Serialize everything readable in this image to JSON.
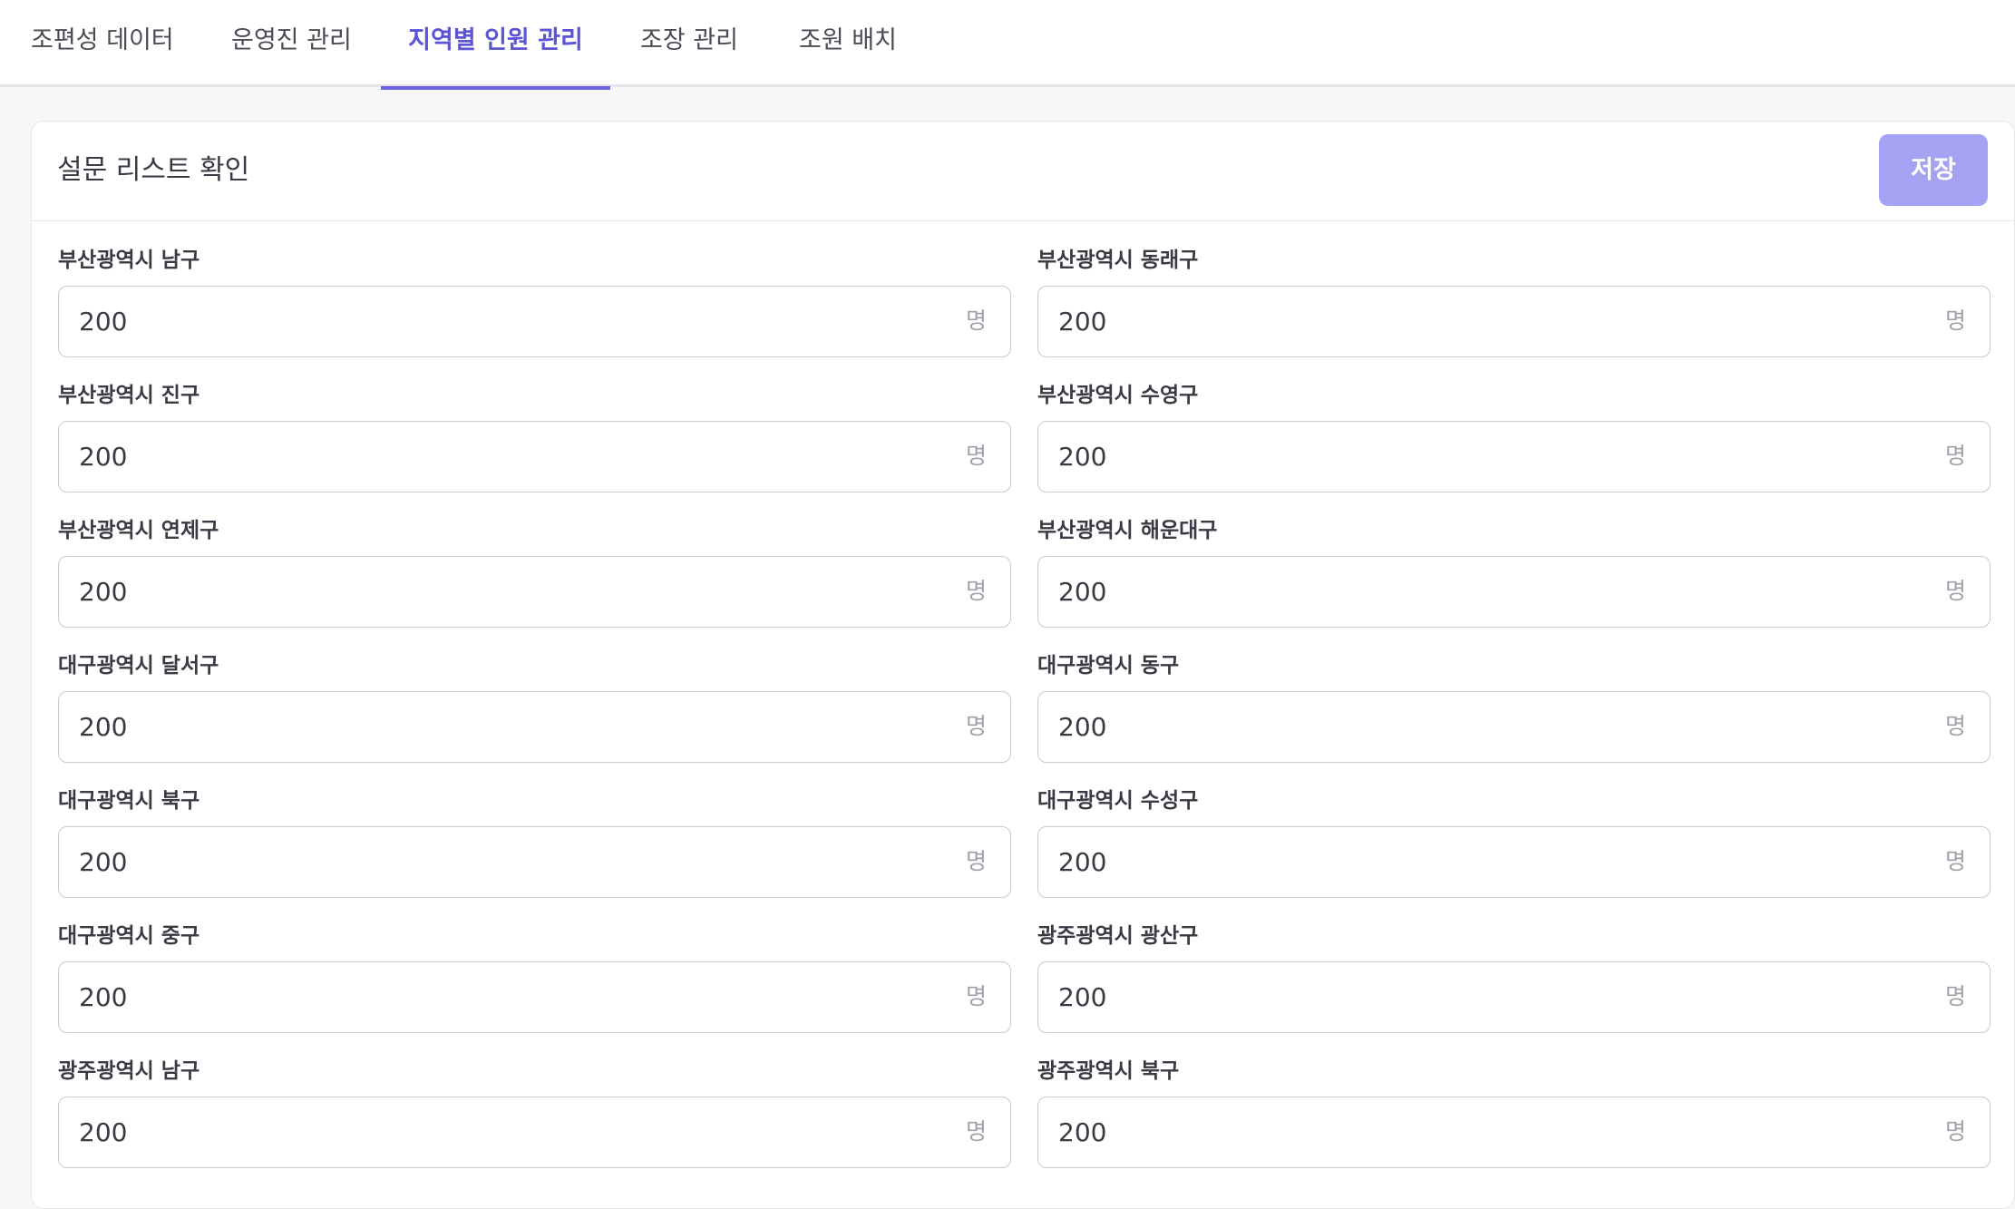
{
  "tabs": [
    {
      "label": "조편성 데이터"
    },
    {
      "label": "운영진 관리"
    },
    {
      "label": "지역별 인원 관리"
    },
    {
      "label": "조장 관리"
    },
    {
      "label": "조원 배치"
    }
  ],
  "active_tab": "지역별 인원 관리",
  "card": {
    "title": "설문 리스트 확인",
    "save_label": "저장"
  },
  "fields": [
    {
      "label": "부산광역시 남구",
      "value": "200",
      "unit": "명"
    },
    {
      "label": "부산광역시 동래구",
      "value": "200",
      "unit": "명"
    },
    {
      "label": "부산광역시 진구",
      "value": "200",
      "unit": "명"
    },
    {
      "label": "부산광역시 수영구",
      "value": "200",
      "unit": "명"
    },
    {
      "label": "부산광역시 연제구",
      "value": "200",
      "unit": "명"
    },
    {
      "label": "부산광역시 해운대구",
      "value": "200",
      "unit": "명"
    },
    {
      "label": "대구광역시 달서구",
      "value": "200",
      "unit": "명"
    },
    {
      "label": "대구광역시 동구",
      "value": "200",
      "unit": "명"
    },
    {
      "label": "대구광역시 북구",
      "value": "200",
      "unit": "명"
    },
    {
      "label": "대구광역시 수성구",
      "value": "200",
      "unit": "명"
    },
    {
      "label": "대구광역시 중구",
      "value": "200",
      "unit": "명"
    },
    {
      "label": "광주광역시 광산구",
      "value": "200",
      "unit": "명"
    },
    {
      "label": "광주광역시 남구",
      "value": "200",
      "unit": "명"
    },
    {
      "label": "광주광역시 북구",
      "value": "200",
      "unit": "명"
    }
  ],
  "colors": {
    "accent": "#5b54d4",
    "save_button": "#a5a2f4",
    "border": "#c9c9d2"
  }
}
